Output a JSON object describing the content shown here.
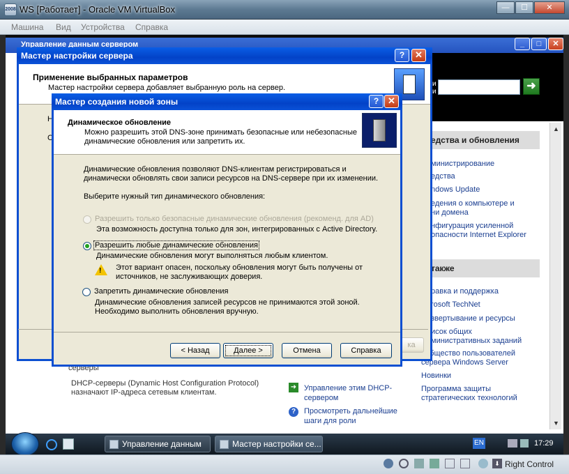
{
  "vbox": {
    "title": "WS [Работает] - Oracle VM VirtualBox",
    "app_icon_text": "2008",
    "menu": [
      "Машина",
      "Вид",
      "Устройства",
      "Справка"
    ],
    "host_key": "Right Control"
  },
  "server_manager": {
    "title": "Управление данным сервером",
    "search_label_1": "и",
    "search_label_2": "и",
    "tools_header": "едства и обновления",
    "tools_links": [
      "министрирование",
      "едства",
      "ndows Update",
      "едения о компьютере и",
      "ни домена",
      "нфигурация усиленной",
      "опасности Internet Explorer"
    ],
    "see_also_header": "также",
    "see_also_links": [
      "равка и поддержка",
      "rosoft TechNet",
      "звертывание и ресурсы",
      "исок общих",
      "министративных заданий",
      "ообщество пользователей",
      "сервера Windows Server",
      "Новинки",
      "Программа защиты",
      "стратегических технологий"
    ],
    "dhcp_partial": "серверы",
    "dhcp_desc_1": "DHCP-серверы (Dynamic Host Configuration Protocol)",
    "dhcp_desc_2": "назначают IP-адреса сетевым клиентам.",
    "dhcp_manage_1": "Управление этим DHCP-",
    "dhcp_manage_2": "сервером",
    "dhcp_next_1": "Просмотреть дальнейшие",
    "dhcp_next_2": "шаги для роли"
  },
  "wizard1": {
    "title": "Мастер настройки сервера",
    "header_title": "Применение выбранных параметров",
    "header_desc": "Мастер настройки сервера добавляет выбранную роль на сервер.",
    "partial_left": "Н",
    "partial_left2": "С",
    "partial_button": "ка"
  },
  "wizard2": {
    "title": "Мастер создания новой зоны",
    "header_title": "Динамическое обновление",
    "header_desc_1": "Можно разрешить этой DNS-зоне принимать безопасные или небезопасные",
    "header_desc_2": "динамические обновления или запретить их.",
    "intro_1": "Динамические обновления позволяют DNS-клиентам регистрироваться и",
    "intro_2": "динамически обновлять свои записи ресурсов на DNS-сервере при их изменении.",
    "prompt": "Выберите нужный тип динамического обновления:",
    "options": [
      {
        "label": "Разрешить только безопасные динамические обновления (рекоменд. для AD)",
        "desc": "Эта возможность доступна только для зон, интегрированных с Active Directory.",
        "state": "disabled"
      },
      {
        "label": "Разрешить любые динамические обновления",
        "desc": "Динамические обновления могут выполняться любым клиентом.",
        "state": "selected"
      },
      {
        "label": "Запретить динамические обновления",
        "desc": "Динамические обновления записей ресурсов не принимаются этой зоной.",
        "desc2": "Необходимо выполнить обновления вручную.",
        "state": "unselected"
      }
    ],
    "warning_1": "Этот вариант опасен, поскольку обновления могут быть получены от",
    "warning_2": "источников, не заслуживающих доверия.",
    "buttons": {
      "back": "< Назад",
      "next": "Далее >",
      "cancel": "Отмена",
      "help": "Справка"
    }
  },
  "taskbar": {
    "items": [
      "Управление данным ...",
      "Мастер настройки се..."
    ],
    "lang": "EN",
    "clock": "17:29"
  },
  "colors": {
    "xp_title_blue": "#0342c7",
    "xp_face": "#ece9d8",
    "link_blue": "#1a3e90",
    "radio_selected": "#21a121"
  }
}
